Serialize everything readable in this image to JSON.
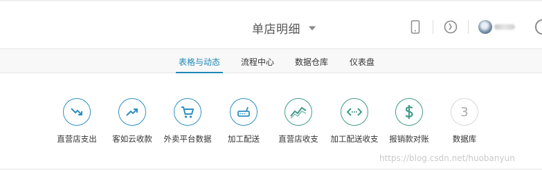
{
  "header": {
    "title": "单店明细",
    "icons": [
      "phone-icon",
      "clock-icon",
      "avatar",
      "user-icon"
    ],
    "user_name": ""
  },
  "tabs": [
    {
      "label": "表格与动态",
      "active": true
    },
    {
      "label": "流程中心",
      "active": false
    },
    {
      "label": "数据仓库",
      "active": false
    },
    {
      "label": "仪表盘",
      "active": false
    }
  ],
  "tiles": [
    {
      "label": "直营店支出",
      "icon": "trend-down-icon"
    },
    {
      "label": "客如云收款",
      "icon": "trend-up-icon"
    },
    {
      "label": "外卖平台数据",
      "icon": "cart-icon"
    },
    {
      "label": "加工配送",
      "icon": "router-icon"
    },
    {
      "label": "直营店收支",
      "icon": "chart-line-icon"
    },
    {
      "label": "加工配送收支",
      "icon": "exchange-icon"
    },
    {
      "label": "报销款对账",
      "icon": "dollar-icon"
    },
    {
      "label": "数据库",
      "icon": "number-badge",
      "badge": "3"
    }
  ],
  "watermark": "https://blog.csdn.net/huobanyun",
  "colors": {
    "accent": "#1e88b8",
    "icon_blue": "#2b8fc0",
    "icon_teal": "#3f9a86"
  }
}
